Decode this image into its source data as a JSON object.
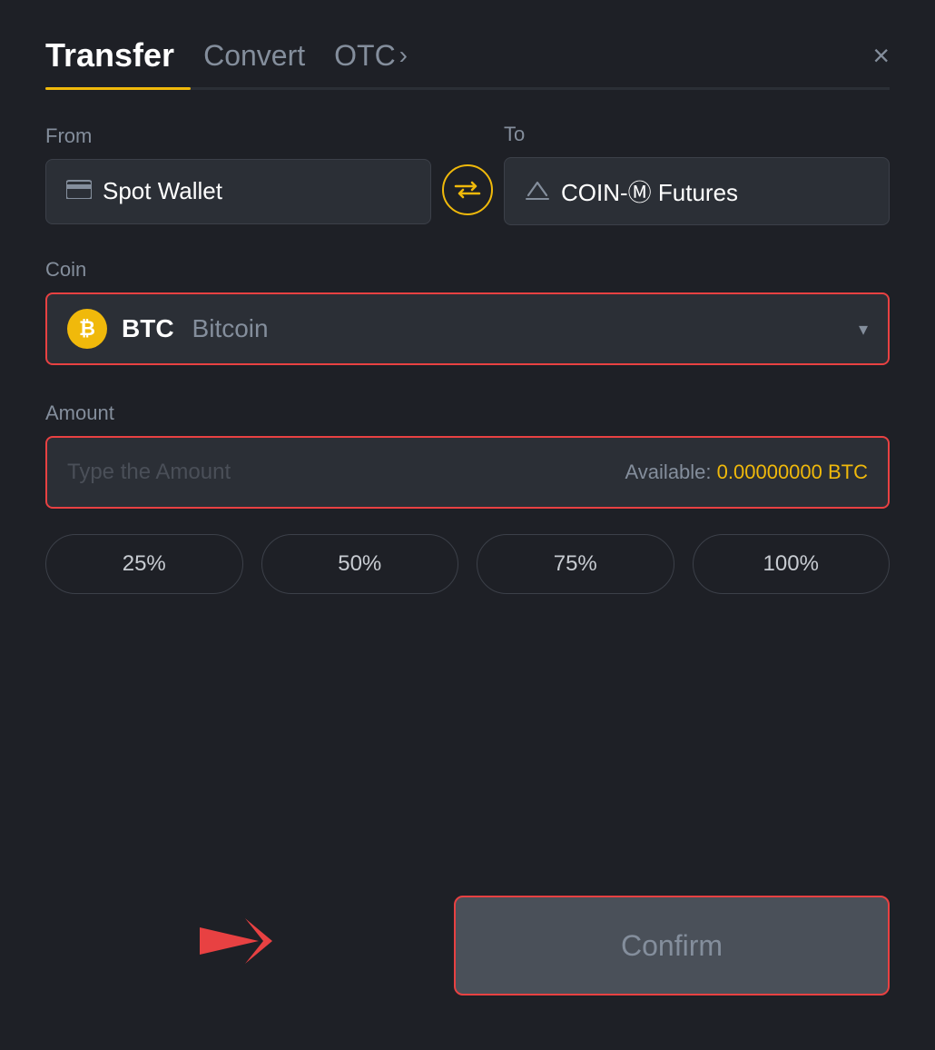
{
  "header": {
    "tab_transfer": "Transfer",
    "tab_convert": "Convert",
    "tab_otc": "OTC",
    "tab_otc_chevron": "›",
    "close_label": "×"
  },
  "from_section": {
    "label": "From",
    "wallet_icon": "▬",
    "wallet_name": "Spot Wallet"
  },
  "to_section": {
    "label": "To",
    "wallet_icon": "↑",
    "wallet_name": "COIN-Ⓜ Futures"
  },
  "swap": {
    "icon": "⇄"
  },
  "coin_section": {
    "label": "Coin",
    "btc_symbol": "₿",
    "coin_ticker": "BTC",
    "coin_name": "Bitcoin",
    "chevron": "▾"
  },
  "amount_section": {
    "label": "Amount",
    "placeholder": "Type the Amount",
    "available_label": "Available:",
    "available_amount": "0.00000000 BTC"
  },
  "percentage_buttons": [
    {
      "label": "25%"
    },
    {
      "label": "50%"
    },
    {
      "label": "75%"
    },
    {
      "label": "100%"
    }
  ],
  "confirm_button": {
    "label": "Confirm"
  }
}
